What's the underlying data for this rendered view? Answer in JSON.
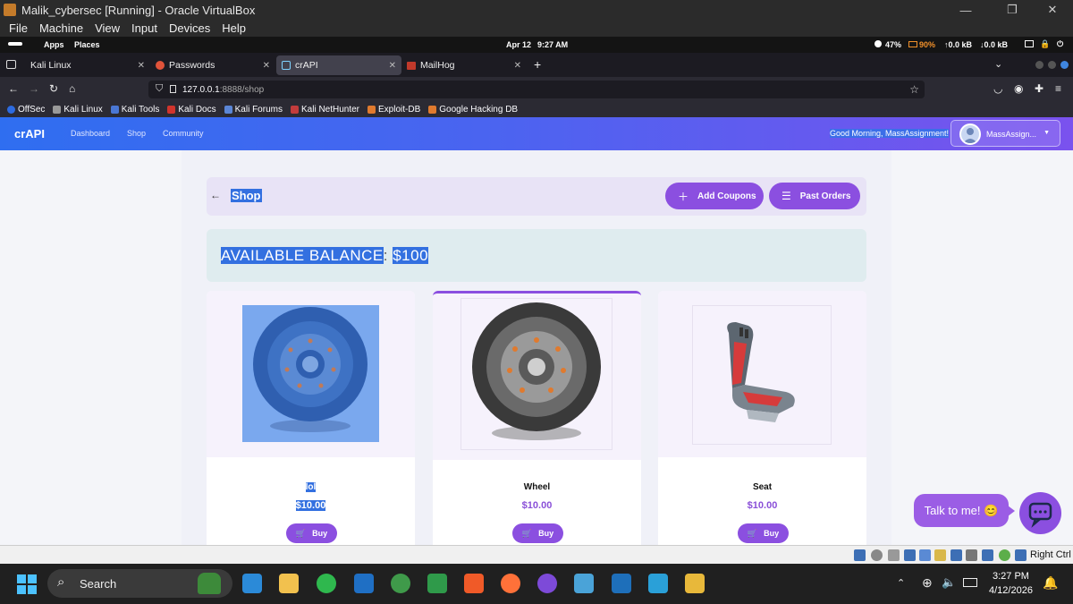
{
  "vbox": {
    "title": "Malik_cybersec [Running] - Oracle VirtualBox",
    "menu": [
      "File",
      "Machine",
      "View",
      "Input",
      "Devices",
      "Help"
    ],
    "host_key": "Right Ctrl"
  },
  "kali_panel": {
    "apps": "Apps",
    "places": "Places",
    "date": "Apr 12",
    "time": "9:27 AM",
    "cpu": "47%",
    "battery": "90%",
    "net_up": "↑0.0 kB",
    "net_down": "↓0.0 kB"
  },
  "browser": {
    "tabs": [
      {
        "label": "Kali Linux"
      },
      {
        "label": "Passwords"
      },
      {
        "label": "crAPI"
      },
      {
        "label": "MailHog"
      }
    ],
    "url_host": "127.0.0.1",
    "url_rest": ":8888/shop",
    "bookmarks": [
      "OffSec",
      "Kali Linux",
      "Kali Tools",
      "Kali Docs",
      "Kali Forums",
      "Kali NetHunter",
      "Exploit-DB",
      "Google Hacking DB"
    ]
  },
  "crapi": {
    "brand": "crAPI",
    "nav": [
      "Dashboard",
      "Shop",
      "Community"
    ],
    "greeting": "Good Morning, MassAssignment!",
    "user_name": "MassAssign...",
    "shop_title": "Shop",
    "add_coupons": "Add Coupons",
    "past_orders": "Past Orders",
    "balance_label": "AVAILABLE BALANCE",
    "balance_sep": ":",
    "balance_value": "$100",
    "products": [
      {
        "name": "lol",
        "price": "$10.00",
        "buy": "Buy"
      },
      {
        "name": "Wheel",
        "price": "$10.00",
        "buy": "Buy"
      },
      {
        "name": "Seat",
        "price": "$10.00",
        "buy": "Buy"
      }
    ],
    "chat_prompt": "Talk to me! 😊"
  },
  "taskbar": {
    "search_placeholder": "Search",
    "time": "3:27 PM",
    "date": "4/12/2026"
  },
  "colors": {
    "accent": "#8b4fe0",
    "header_start": "#2f6ef0",
    "header_end": "#7a52ee",
    "selection": "#3370e0"
  }
}
